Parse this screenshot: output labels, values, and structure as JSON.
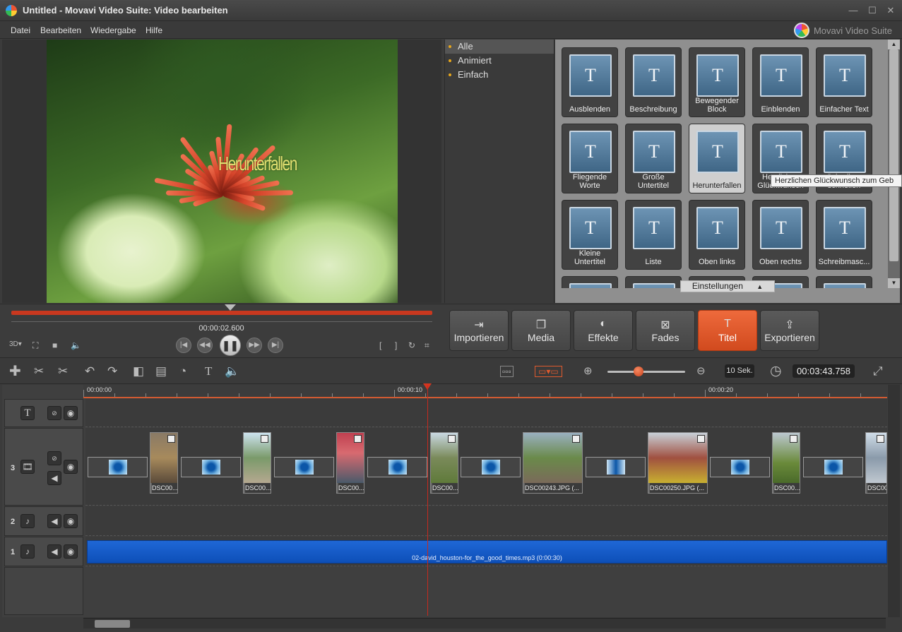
{
  "window": {
    "title": "Untitled - Movavi Video Suite: Video bearbeiten",
    "minimize": "—",
    "maximize": "☐",
    "close": "✕"
  },
  "menu": {
    "items": [
      "Datei",
      "Bearbeiten",
      "Wiedergabe",
      "Hilfe"
    ],
    "brand": "Movavi Video Suite"
  },
  "preview": {
    "overlay_text": "Herunterfallen"
  },
  "categories": [
    {
      "label": "Alle",
      "selected": true
    },
    {
      "label": "Animiert",
      "selected": false
    },
    {
      "label": "Einfach",
      "selected": false
    }
  ],
  "title_tiles": {
    "glyph": "T",
    "items": [
      [
        "Ausblenden",
        "Beschreibung",
        "Bewegender Block",
        "Einblenden",
        "Einfacher Text"
      ],
      [
        "Fliegende Worte",
        "Große Untertitel",
        "Herunterfallen",
        "Herzlichen Glückwunsch",
        "Schreiben schnellen"
      ],
      [
        "Kleine Untertitel",
        "Liste",
        "Oben links",
        "Oben rechts",
        "Schreibmasc..."
      ]
    ],
    "highlighted": "Herunterfallen"
  },
  "settings_bar": {
    "label": "Einstellungen",
    "arrow": "▲"
  },
  "tooltip": "Herzlichen Glückwunsch zum Geb",
  "player": {
    "timecode": "00:00:02.600"
  },
  "tabs": [
    {
      "label": "Importieren",
      "icon": "import-icon",
      "glyph": "⇥",
      "active": false
    },
    {
      "label": "Media",
      "icon": "media-icon",
      "glyph": "❐",
      "active": false
    },
    {
      "label": "Effekte",
      "icon": "effects-icon",
      "glyph": "◐",
      "active": false
    },
    {
      "label": "Fades",
      "icon": "fades-icon",
      "glyph": "⊠",
      "active": false
    },
    {
      "label": "Titel",
      "icon": "title-icon",
      "glyph": "T",
      "active": true
    },
    {
      "label": "Exportieren",
      "icon": "export-icon",
      "glyph": "⇪",
      "active": false
    }
  ],
  "timeline_toolbar": {
    "zoom_label": "10 Sek.",
    "duration": "00:03:43.758",
    "zoom_level": 0.4
  },
  "ruler": {
    "labels": [
      "00:00:00",
      "00:00:10",
      "00:00:20"
    ]
  },
  "tracks": {
    "title_track": {
      "glyph": "T"
    },
    "video_track": {
      "number": "3",
      "clips": [
        "DSC00...",
        "DSC00...",
        "DSC00...",
        "DSC00...",
        "DSC00243.JPG (...",
        "DSC00250.JPG (...",
        "DSC00...",
        "DSC00"
      ]
    },
    "audio2": {
      "number": "2"
    },
    "audio1": {
      "number": "1",
      "clip_label": "02-david_houston-for_the_good_times.mp3 (0:00:30)"
    }
  },
  "colors": {
    "accent": "#e05a2e",
    "audio_clip": "#1556c6",
    "playhead": "#c62a1f"
  }
}
